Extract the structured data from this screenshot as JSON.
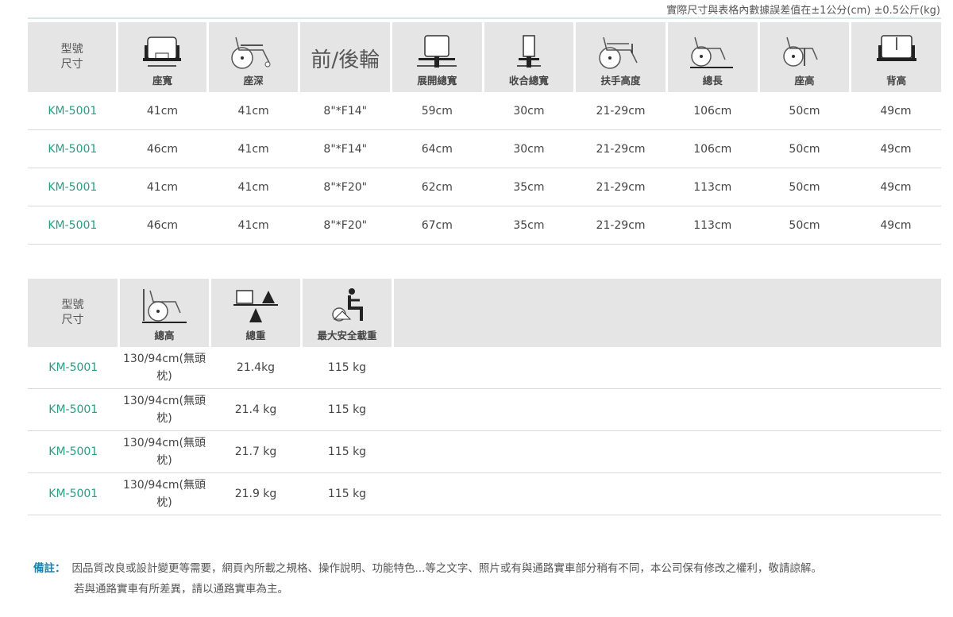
{
  "top_note": "實際尺寸與表格內數據誤差值在±1公分(cm) ±0.5公斤(kg)",
  "table1": {
    "model_header": [
      "型號",
      "尺寸"
    ],
    "columns": [
      {
        "label": "座寬",
        "icon": "seat-width-icon"
      },
      {
        "label": "座深",
        "icon": "seat-depth-icon"
      },
      {
        "label": "前/後輪",
        "icon": ""
      },
      {
        "label": "展開總寬",
        "icon": "open-width-icon"
      },
      {
        "label": "收合總寬",
        "icon": "folded-width-icon"
      },
      {
        "label": "扶手高度",
        "icon": "armrest-height-icon"
      },
      {
        "label": "總長",
        "icon": "total-length-icon"
      },
      {
        "label": "座高",
        "icon": "seat-height-icon"
      },
      {
        "label": "背高",
        "icon": "back-height-icon"
      }
    ],
    "rows": [
      [
        "KM-5001",
        "41cm",
        "41cm",
        "8\"*F14\"",
        "59cm",
        "30cm",
        "21-29cm",
        "106cm",
        "50cm",
        "49cm"
      ],
      [
        "KM-5001",
        "46cm",
        "41cm",
        "8\"*F14\"",
        "64cm",
        "30cm",
        "21-29cm",
        "106cm",
        "50cm",
        "49cm"
      ],
      [
        "KM-5001",
        "41cm",
        "41cm",
        "8\"*F20\"",
        "62cm",
        "35cm",
        "21-29cm",
        "113cm",
        "50cm",
        "49cm"
      ],
      [
        "KM-5001",
        "46cm",
        "41cm",
        "8\"*F20\"",
        "67cm",
        "35cm",
        "21-29cm",
        "113cm",
        "50cm",
        "49cm"
      ]
    ]
  },
  "table2": {
    "model_header": [
      "型號",
      "尺寸"
    ],
    "columns": [
      {
        "label": "總高",
        "icon": "total-height-icon"
      },
      {
        "label": "總重",
        "icon": "total-weight-icon"
      },
      {
        "label": "最大安全載重",
        "icon": "max-load-icon"
      }
    ],
    "rows": [
      [
        "KM-5001",
        "130/94cm(無頭枕)",
        "21.4kg",
        "115 kg"
      ],
      [
        "KM-5001",
        "130/94cm(無頭枕)",
        "21.4 kg",
        "115 kg"
      ],
      [
        "KM-5001",
        "130/94cm(無頭枕)",
        "21.7 kg",
        "115 kg"
      ],
      [
        "KM-5001",
        "130/94cm(無頭枕)",
        "21.9 kg",
        "115 kg"
      ]
    ]
  },
  "remark": {
    "label": "備註：",
    "line1": "因品質改良或設計變更等需要，網頁內所載之規格、操作說明、功能特色...等之文字、照片或有與通路實車部分稍有不同，本公司保有修改之權利，敬請諒解。",
    "line2": "若與通路實車有所差異，請以通路實車為主。"
  }
}
